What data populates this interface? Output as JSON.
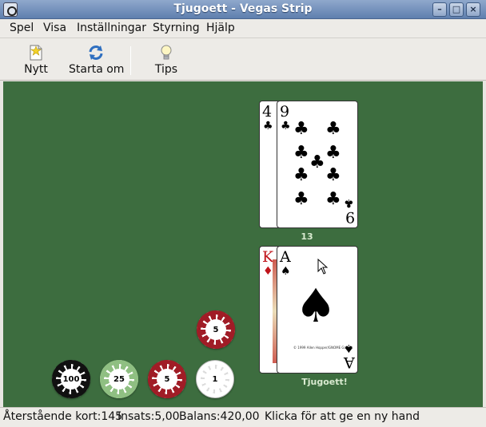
{
  "window": {
    "title": "Tjugoett - Vegas Strip",
    "controls": [
      "minimize",
      "maximize",
      "close"
    ]
  },
  "menu": [
    "Spel",
    "Visa",
    "Inställningar",
    "Styrning",
    "Hjälp"
  ],
  "toolbar": {
    "new_label": "Nytt",
    "restart_label": "Starta om",
    "tips_label": "Tips"
  },
  "dealer": {
    "cards": [
      {
        "rank": "4",
        "suit": "♣",
        "color": "black"
      },
      {
        "rank": "9",
        "suit": "♣",
        "color": "black"
      }
    ],
    "total": "13"
  },
  "player": {
    "cards": [
      {
        "rank": "K",
        "suit": "♦",
        "color": "red"
      },
      {
        "rank": "A",
        "suit": "♠",
        "color": "black"
      }
    ],
    "result": "Tjugoett!",
    "card_fineprint": "© 1999 Allen Hopper/GNOME Games"
  },
  "bet_chip": {
    "value": "5",
    "color": "#a01c26"
  },
  "chips": [
    {
      "value": "100",
      "color": "#111111"
    },
    {
      "value": "25",
      "color": "#8fbf82"
    },
    {
      "value": "5",
      "color": "#a01c26"
    },
    {
      "value": "1",
      "color": "#ffffff"
    }
  ],
  "status": {
    "remaining": "Återstående kort:145",
    "bet": "Insats:5,00",
    "balance": "Balans:420,00",
    "message": "Klicka för att ge en ny hand"
  },
  "colors": {
    "felt": "#3d6d3f",
    "titlebar": "#5f7fae"
  }
}
